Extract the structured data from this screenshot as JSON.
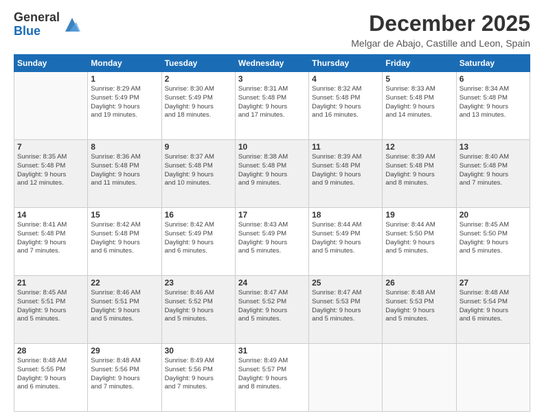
{
  "logo": {
    "general": "General",
    "blue": "Blue"
  },
  "title": "December 2025",
  "location": "Melgar de Abajo, Castille and Leon, Spain",
  "days_of_week": [
    "Sunday",
    "Monday",
    "Tuesday",
    "Wednesday",
    "Thursday",
    "Friday",
    "Saturday"
  ],
  "weeks": [
    [
      {
        "day": "",
        "info": ""
      },
      {
        "day": "1",
        "info": "Sunrise: 8:29 AM\nSunset: 5:49 PM\nDaylight: 9 hours\nand 19 minutes."
      },
      {
        "day": "2",
        "info": "Sunrise: 8:30 AM\nSunset: 5:49 PM\nDaylight: 9 hours\nand 18 minutes."
      },
      {
        "day": "3",
        "info": "Sunrise: 8:31 AM\nSunset: 5:48 PM\nDaylight: 9 hours\nand 17 minutes."
      },
      {
        "day": "4",
        "info": "Sunrise: 8:32 AM\nSunset: 5:48 PM\nDaylight: 9 hours\nand 16 minutes."
      },
      {
        "day": "5",
        "info": "Sunrise: 8:33 AM\nSunset: 5:48 PM\nDaylight: 9 hours\nand 14 minutes."
      },
      {
        "day": "6",
        "info": "Sunrise: 8:34 AM\nSunset: 5:48 PM\nDaylight: 9 hours\nand 13 minutes."
      }
    ],
    [
      {
        "day": "7",
        "info": "Sunrise: 8:35 AM\nSunset: 5:48 PM\nDaylight: 9 hours\nand 12 minutes."
      },
      {
        "day": "8",
        "info": "Sunrise: 8:36 AM\nSunset: 5:48 PM\nDaylight: 9 hours\nand 11 minutes."
      },
      {
        "day": "9",
        "info": "Sunrise: 8:37 AM\nSunset: 5:48 PM\nDaylight: 9 hours\nand 10 minutes."
      },
      {
        "day": "10",
        "info": "Sunrise: 8:38 AM\nSunset: 5:48 PM\nDaylight: 9 hours\nand 9 minutes."
      },
      {
        "day": "11",
        "info": "Sunrise: 8:39 AM\nSunset: 5:48 PM\nDaylight: 9 hours\nand 9 minutes."
      },
      {
        "day": "12",
        "info": "Sunrise: 8:39 AM\nSunset: 5:48 PM\nDaylight: 9 hours\nand 8 minutes."
      },
      {
        "day": "13",
        "info": "Sunrise: 8:40 AM\nSunset: 5:48 PM\nDaylight: 9 hours\nand 7 minutes."
      }
    ],
    [
      {
        "day": "14",
        "info": "Sunrise: 8:41 AM\nSunset: 5:48 PM\nDaylight: 9 hours\nand 7 minutes."
      },
      {
        "day": "15",
        "info": "Sunrise: 8:42 AM\nSunset: 5:48 PM\nDaylight: 9 hours\nand 6 minutes."
      },
      {
        "day": "16",
        "info": "Sunrise: 8:42 AM\nSunset: 5:49 PM\nDaylight: 9 hours\nand 6 minutes."
      },
      {
        "day": "17",
        "info": "Sunrise: 8:43 AM\nSunset: 5:49 PM\nDaylight: 9 hours\nand 5 minutes."
      },
      {
        "day": "18",
        "info": "Sunrise: 8:44 AM\nSunset: 5:49 PM\nDaylight: 9 hours\nand 5 minutes."
      },
      {
        "day": "19",
        "info": "Sunrise: 8:44 AM\nSunset: 5:50 PM\nDaylight: 9 hours\nand 5 minutes."
      },
      {
        "day": "20",
        "info": "Sunrise: 8:45 AM\nSunset: 5:50 PM\nDaylight: 9 hours\nand 5 minutes."
      }
    ],
    [
      {
        "day": "21",
        "info": "Sunrise: 8:45 AM\nSunset: 5:51 PM\nDaylight: 9 hours\nand 5 minutes."
      },
      {
        "day": "22",
        "info": "Sunrise: 8:46 AM\nSunset: 5:51 PM\nDaylight: 9 hours\nand 5 minutes."
      },
      {
        "day": "23",
        "info": "Sunrise: 8:46 AM\nSunset: 5:52 PM\nDaylight: 9 hours\nand 5 minutes."
      },
      {
        "day": "24",
        "info": "Sunrise: 8:47 AM\nSunset: 5:52 PM\nDaylight: 9 hours\nand 5 minutes."
      },
      {
        "day": "25",
        "info": "Sunrise: 8:47 AM\nSunset: 5:53 PM\nDaylight: 9 hours\nand 5 minutes."
      },
      {
        "day": "26",
        "info": "Sunrise: 8:48 AM\nSunset: 5:53 PM\nDaylight: 9 hours\nand 5 minutes."
      },
      {
        "day": "27",
        "info": "Sunrise: 8:48 AM\nSunset: 5:54 PM\nDaylight: 9 hours\nand 6 minutes."
      }
    ],
    [
      {
        "day": "28",
        "info": "Sunrise: 8:48 AM\nSunset: 5:55 PM\nDaylight: 9 hours\nand 6 minutes."
      },
      {
        "day": "29",
        "info": "Sunrise: 8:48 AM\nSunset: 5:56 PM\nDaylight: 9 hours\nand 7 minutes."
      },
      {
        "day": "30",
        "info": "Sunrise: 8:49 AM\nSunset: 5:56 PM\nDaylight: 9 hours\nand 7 minutes."
      },
      {
        "day": "31",
        "info": "Sunrise: 8:49 AM\nSunset: 5:57 PM\nDaylight: 9 hours\nand 8 minutes."
      },
      {
        "day": "",
        "info": ""
      },
      {
        "day": "",
        "info": ""
      },
      {
        "day": "",
        "info": ""
      }
    ]
  ]
}
